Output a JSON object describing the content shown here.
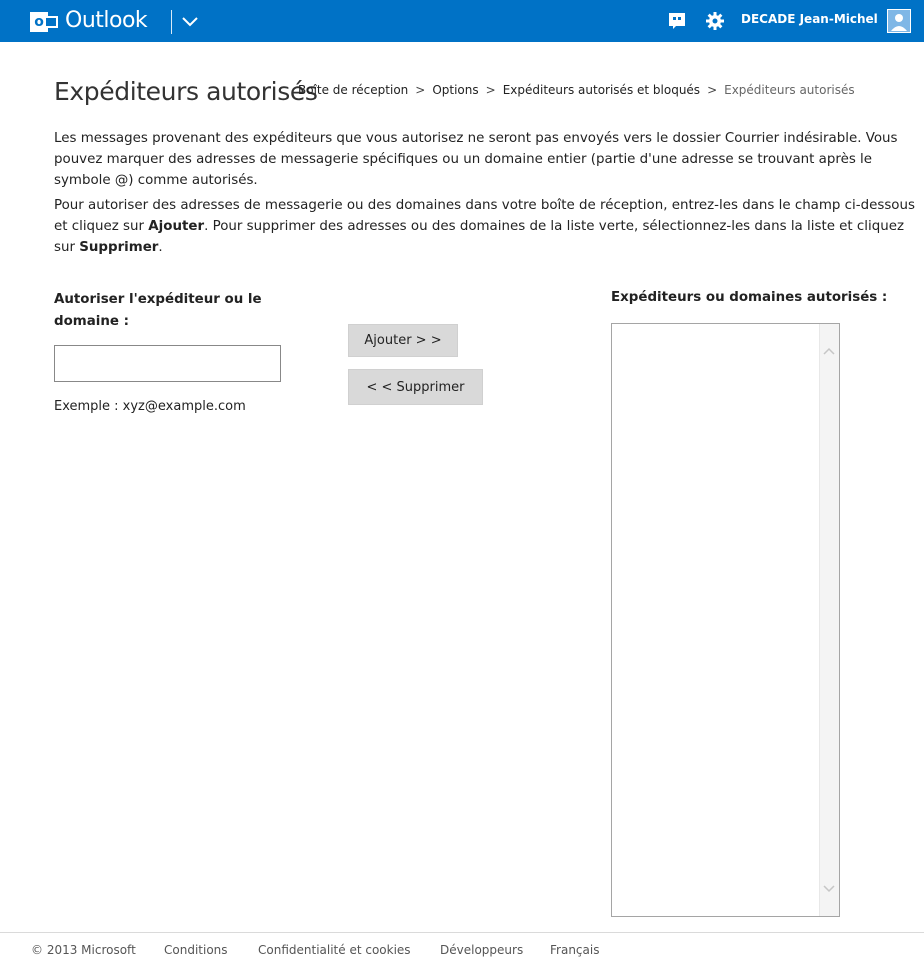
{
  "header": {
    "app_name": "Outlook",
    "user_name": "DECADE Jean-Michel",
    "icons": [
      "outlook-logo-icon",
      "chevron-down-icon",
      "chat-icon",
      "gear-icon",
      "avatar"
    ],
    "accent": "#0072c6"
  },
  "page": {
    "title": "Expéditeurs autorisés",
    "breadcrumb": [
      {
        "label": "Boîte de réception"
      },
      {
        "label": "Options"
      },
      {
        "label": "Expéditeurs autorisés et bloqués"
      },
      {
        "label": "Expéditeurs autorisés"
      }
    ],
    "breadcrumb_separator": ">"
  },
  "intro": {
    "paragraph1": "Les messages provenant des expéditeurs que vous autorisez ne seront pas envoyés vers le dossier Courrier indésirable. Vous pouvez marquer des adresses de messagerie spécifiques ou un domaine entier (partie d'une adresse se trouvant après le symbole @) comme autorisés.",
    "paragraph2_a": "Pour autoriser des adresses de messagerie ou des domaines dans votre boîte de réception, entrez-les dans le champ ci-dessous et cliquez sur ",
    "paragraph2_b": "Ajouter",
    "paragraph2_c": ". Pour supprimer des adresses ou des domaines de la liste verte, sélectionnez-les dans la liste et cliquez sur ",
    "paragraph2_d": "Supprimer",
    "paragraph2_e": "."
  },
  "form": {
    "input_label": "Autoriser l'expéditeur ou le domaine :",
    "input_value": "",
    "example": "Exemple : xyz@example.com",
    "add_button": "Ajouter > >",
    "remove_button": "< < Supprimer",
    "list_label": "Expéditeurs ou domaines autorisés :",
    "list_items": []
  },
  "footer": {
    "copyright": "© 2013 Microsoft",
    "links": [
      "Conditions",
      "Confidentialité et cookies",
      "Développeurs",
      "Français"
    ]
  }
}
